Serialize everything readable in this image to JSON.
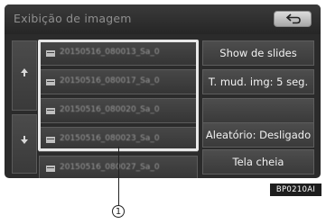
{
  "header": {
    "title": "Exibição de imagem",
    "back_icon": "return-arrow-icon"
  },
  "scroll": {
    "up_icon": "arrow-up-icon",
    "down_icon": "arrow-down-icon"
  },
  "file_list": {
    "items": [
      {
        "name": "20150516_080013_Sa_0",
        "icon": "image-file-icon"
      },
      {
        "name": "20150516_080017_Sa_0",
        "icon": "image-file-icon"
      },
      {
        "name": "20150516_080020_Sa_0",
        "icon": "image-file-icon"
      },
      {
        "name": "20150516_080023_Sa_0",
        "icon": "image-file-icon"
      },
      {
        "name": "20150516_080027_Sa_0",
        "icon": "image-file-icon"
      }
    ]
  },
  "menu": {
    "slideshow": "Show de slides",
    "change_time": "T. mud. img: 5 seg.",
    "random": "Aleatório: Desligado",
    "fullscreen": "Tela cheia"
  },
  "annotation": {
    "callout_number": "1",
    "figure_code": "BP0210AI"
  },
  "colors": {
    "screen_bg": "#2b2b2b",
    "button_text": "#f2f2f2",
    "highlight": "#e8e8e8"
  }
}
